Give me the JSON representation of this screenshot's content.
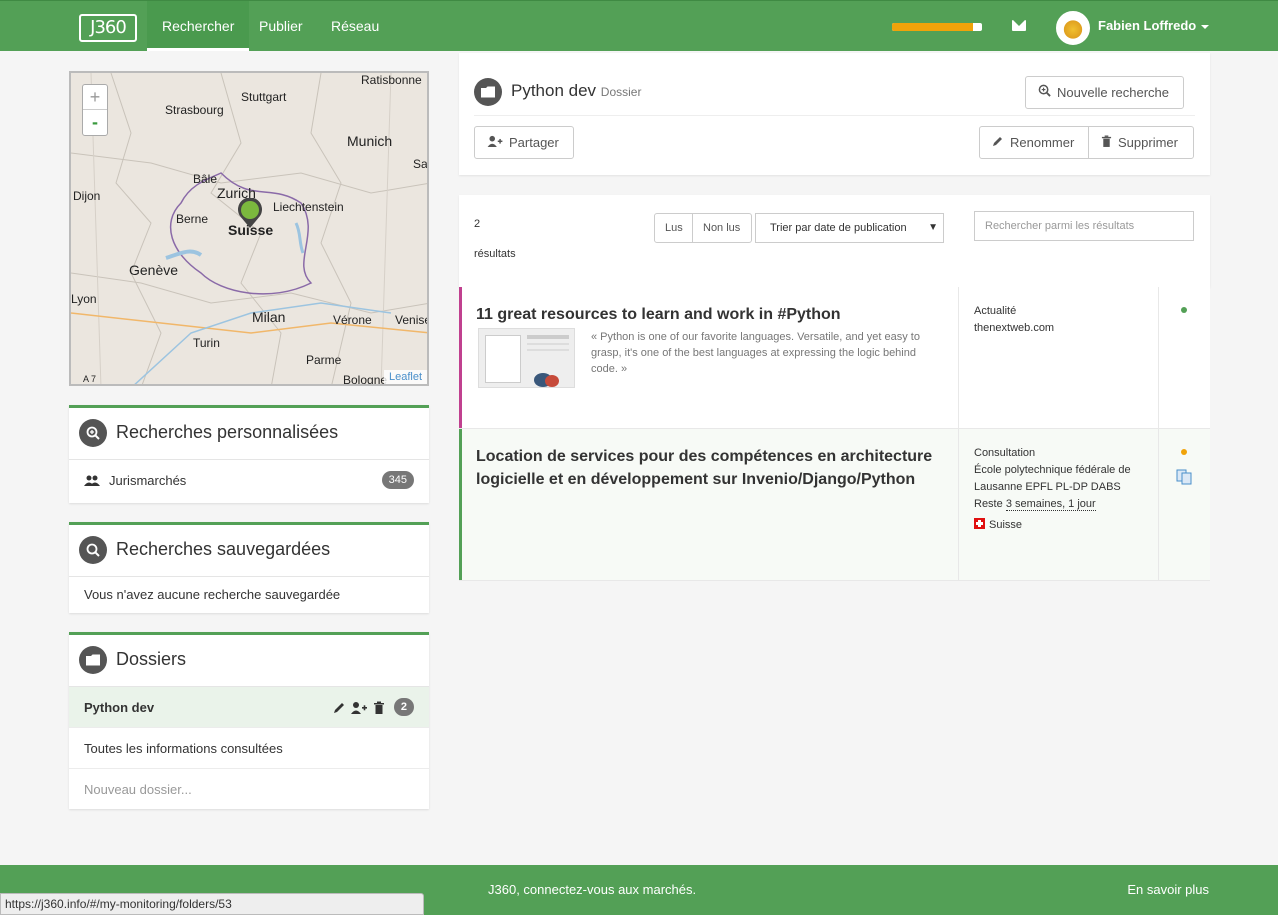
{
  "nav": {
    "logo": "J360",
    "items": [
      "Rechercher",
      "Publier",
      "Réseau"
    ],
    "progress_fraction": 0.9,
    "user": "Fabien Loffredo"
  },
  "map": {
    "zoom_in": "+",
    "zoom_out": "-",
    "labels": [
      "Ratisbonne",
      "Stuttgart",
      "Strasbourg",
      "Munich",
      "Salz",
      "Dijon",
      "Bâle",
      "Zurich",
      "Liechtenstein",
      "Berne",
      "Suisse",
      "Genève",
      "Lyon",
      "Milan",
      "Vérone",
      "Venise",
      "Turin",
      "Parme",
      "Bologne",
      "A 7"
    ],
    "attribution": "Leaflet"
  },
  "custom_search": {
    "title": "Recherches personnalisées",
    "items": [
      {
        "label": "Jurismarchés",
        "count": "345"
      }
    ]
  },
  "saved_search": {
    "title": "Recherches sauvegardées",
    "empty": "Vous n'avez aucune recherche sauvegardée"
  },
  "folders": {
    "title": "Dossiers",
    "active": {
      "label": "Python dev",
      "count": "2"
    },
    "items": [
      "Toutes les informations consultées"
    ],
    "new_placeholder": "Nouveau dossier..."
  },
  "folder_header": {
    "name": "Python dev",
    "type": "Dossier",
    "new_search": "Nouvelle recherche",
    "share": "Partager",
    "rename": "Renommer",
    "delete": "Supprimer"
  },
  "results": {
    "count": "2",
    "count_label": "résultats",
    "filter_read": "Lus",
    "filter_unread": "Non lus",
    "sort": "Trier par date de publication",
    "search_placeholder": "Rechercher parmi les résultats",
    "items": [
      {
        "title": "11 great resources to learn and work in #Python",
        "excerpt": "« Python is one of our favorite languages. Versatile, and yet easy to grasp, it's one of the best languages at expressing the logic behind code. »",
        "category": "Actualité",
        "source": "thenextweb.com",
        "bar_color": "#c0408f",
        "dot_color": "#53a056"
      },
      {
        "title": "Location de services pour des compétences en architecture logicielle et en développement sur Invenio/Django/Python",
        "category": "Consultation",
        "org": "École polytechnique fédérale de Lausanne EPFL PL-DP DABS",
        "remaining_prefix": "Reste",
        "remaining": "3 semaines, 1 jour",
        "country": "Suisse",
        "bar_color": "#53a056",
        "dot_color": "#f0a30a"
      }
    ]
  },
  "footer": {
    "tagline": "J360, connectez-vous aux marchés.",
    "more": "En savoir plus"
  },
  "status_url": "https://j360.info/#/my-monitoring/folders/53"
}
